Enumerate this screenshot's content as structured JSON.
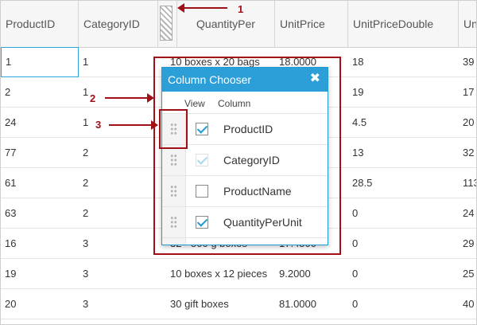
{
  "grid": {
    "columns": [
      "ProductID",
      "CategoryID",
      "QuantityPer",
      "UnitPrice",
      "UnitPriceDouble",
      "Un"
    ],
    "rows": [
      [
        "1",
        "1",
        "10 boxes x 20 bags",
        "18.0000",
        "18",
        "39"
      ],
      [
        "2",
        "1",
        "",
        "",
        "19",
        "17"
      ],
      [
        "24",
        "1",
        "",
        "",
        "4.5",
        "20"
      ],
      [
        "77",
        "2",
        "",
        "",
        "13",
        "32"
      ],
      [
        "61",
        "2",
        "",
        "",
        "28.5",
        "113"
      ],
      [
        "63",
        "2",
        "",
        "",
        "0",
        "24"
      ],
      [
        "16",
        "3",
        "32 - 500 g boxes",
        "17.4500",
        "0",
        "29"
      ],
      [
        "19",
        "3",
        "10 boxes x 12 pieces",
        "9.2000",
        "0",
        "25"
      ],
      [
        "20",
        "3",
        "30 gift boxes",
        "81.0000",
        "0",
        "40"
      ]
    ]
  },
  "chooser": {
    "title": "Column Chooser",
    "close": "✖",
    "col_view": "View",
    "col_column": "Column",
    "items": [
      {
        "label": "ProductID",
        "checked": true,
        "disabled": false
      },
      {
        "label": "CategoryID",
        "checked": true,
        "disabled": true
      },
      {
        "label": "ProductName",
        "checked": false,
        "disabled": false
      },
      {
        "label": "QuantityPerUnit",
        "checked": true,
        "disabled": false
      }
    ]
  },
  "annotations": {
    "one": "1",
    "two": "2",
    "three": "3"
  },
  "colors": {
    "accent": "#2c9fd8",
    "annotation": "#a01016"
  }
}
